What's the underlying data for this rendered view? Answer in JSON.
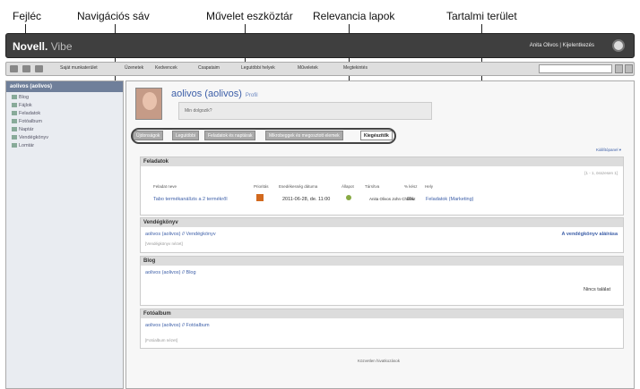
{
  "callouts": {
    "header": "Fejléc",
    "nav": "Navigációs sáv",
    "toolbar": "Művelet eszköztár",
    "tabs": "Relevancia lapok",
    "content": "Tartalmi terület"
  },
  "header": {
    "logo_main": "Novell.",
    "logo_sub": "Vibe",
    "user": "Anita Olivos  |  Kijelentkezés"
  },
  "toolbar": {
    "items": [
      "Saját munkaterület",
      "Üzenetek",
      "Kedvencek",
      "Csapataim",
      "Legutóbbi helyek",
      "Műveletek",
      "Megtekintés"
    ]
  },
  "nav": {
    "title": "aolivos (aolivos)",
    "items": [
      "Blog",
      "Fájlok",
      "Feladatok",
      "Fotóalbum",
      "Naptár",
      "Vendégkönyv",
      "Lomtár"
    ]
  },
  "profile": {
    "name": "aolivos (aolivos)",
    "profile_link": "Profil",
    "status_prompt": "Min dolgozik?"
  },
  "tabs": [
    "Újdonságok",
    "Legutóbbi",
    "Feladatok és naptárak",
    "Mikrobeggek és megosztott elemek",
    "Kiegészítők"
  ],
  "kiegeszitok": "Kiegészítők",
  "custom_panel": "Kiállítópanel ▾",
  "sections": {
    "feladatok": {
      "title": "Feladatok",
      "count": "[1 - 1, összesen 1]",
      "cols": [
        "Feladat neve",
        "Prioritás",
        "Esedékesség dátuma",
        "Állapot",
        "Társítva",
        "% kész",
        "Hely"
      ],
      "row": {
        "name": "Tabo termékanálízis a 2 termékről",
        "due": "2011-06-28, de. 11:00",
        "assigned": "Anita Olivos  John Chavez",
        "pct": "0%",
        "place": "Feladatok (Marketing)"
      }
    },
    "vendegkonyv": {
      "title": "Vendégkönyv",
      "link": "aolivos (aolivos) // Vendégkönyv",
      "sign": "A vendégkönyv aláírása",
      "note": "[Vendégkönyv nézet]"
    },
    "blog": {
      "title": "Blog",
      "link": "aolivos (aolivos) // Blog",
      "none": "Nincs találat"
    },
    "fotoalbum": {
      "title": "Fotóalbum",
      "link": "aolivos (aolivos) // Fotóalbum",
      "note": "[Fotóalbum nézet]"
    }
  },
  "footer": "Közvetlen hivatkozások"
}
